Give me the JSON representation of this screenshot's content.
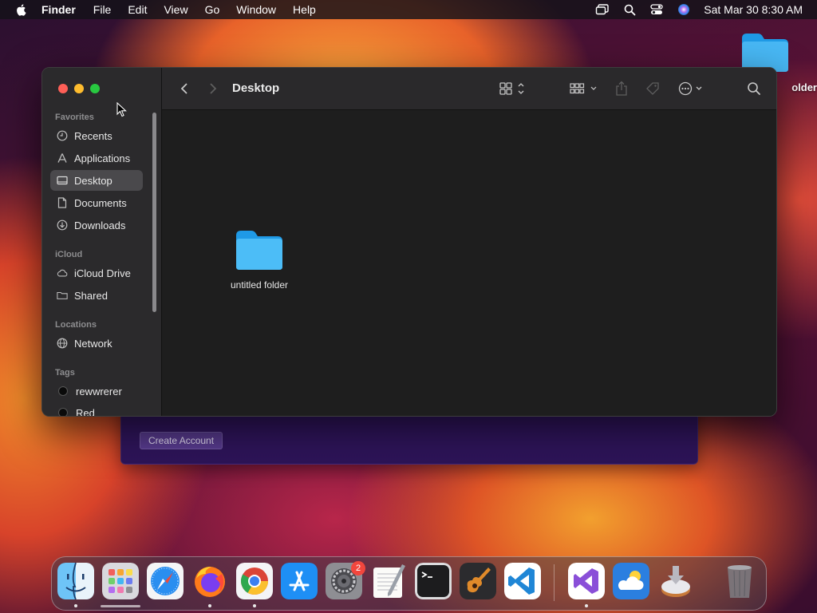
{
  "menubar": {
    "app_name": "Finder",
    "menus": [
      "File",
      "Edit",
      "View",
      "Go",
      "Window",
      "Help"
    ],
    "clock": "Sat Mar 30  8:30 AM",
    "status_icons": [
      "screen-mirroring-icon",
      "spotlight-search-icon",
      "control-center-icon",
      "siri-icon"
    ]
  },
  "desktop": {
    "folder_label": "older"
  },
  "background_window": {
    "button_label": "Create Account",
    "color": "#2d1458"
  },
  "finder": {
    "title": "Desktop",
    "sidebar": {
      "favorites_header": "Favorites",
      "favorites": [
        {
          "label": "Recents",
          "icon": "clock-icon"
        },
        {
          "label": "Applications",
          "icon": "applications-icon"
        },
        {
          "label": "Desktop",
          "icon": "desktop-icon",
          "selected": true
        },
        {
          "label": "Documents",
          "icon": "document-icon"
        },
        {
          "label": "Downloads",
          "icon": "download-icon"
        }
      ],
      "icloud_header": "iCloud",
      "icloud": [
        {
          "label": "iCloud Drive",
          "icon": "cloud-icon"
        },
        {
          "label": "Shared",
          "icon": "shared-folder-icon"
        }
      ],
      "locations_header": "Locations",
      "locations": [
        {
          "label": "Network",
          "icon": "globe-icon"
        }
      ],
      "tags_header": "Tags",
      "tags": [
        {
          "label": "rewwrerer",
          "color": "#0a0a0a"
        },
        {
          "label": "Red",
          "color": "#0a0a0a"
        }
      ]
    },
    "items": [
      {
        "name": "untitled folder",
        "icon": "folder-icon"
      }
    ]
  },
  "dock": {
    "apps": [
      {
        "name": "Finder",
        "icon": "finder-icon",
        "running": true
      },
      {
        "name": "Launchpad",
        "icon": "launchpad-icon",
        "running": false
      },
      {
        "name": "Safari",
        "icon": "safari-icon",
        "running": false
      },
      {
        "name": "Firefox",
        "icon": "firefox-icon",
        "running": true
      },
      {
        "name": "Chrome",
        "icon": "chrome-icon",
        "running": true
      },
      {
        "name": "App Store",
        "icon": "app-store-icon",
        "running": false
      },
      {
        "name": "System Settings",
        "icon": "system-settings-icon",
        "running": false,
        "badge": "2"
      },
      {
        "name": "TextEdit",
        "icon": "textedit-icon",
        "running": false
      },
      {
        "name": "Terminal",
        "icon": "terminal-icon",
        "running": false
      },
      {
        "name": "GarageBand",
        "icon": "garageband-icon",
        "running": false
      },
      {
        "name": "Visual Studio Code",
        "icon": "vscode-icon",
        "running": false
      },
      {
        "name": "Visual Studio",
        "icon": "visual-studio-icon",
        "running": true
      },
      {
        "name": "Weather",
        "icon": "weather-icon",
        "running": false
      },
      {
        "name": "Installer",
        "icon": "installer-icon",
        "running": false
      },
      {
        "name": "Trash",
        "icon": "trash-icon",
        "running": false
      }
    ],
    "colors": {
      "accent_badge": "#f2463d"
    }
  }
}
